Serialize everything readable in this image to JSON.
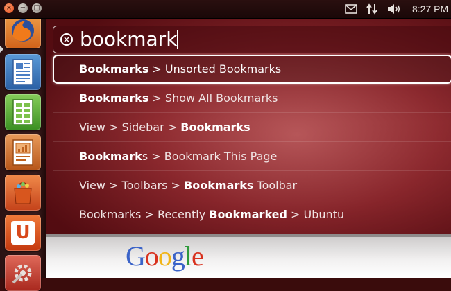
{
  "panel": {
    "close_glyph": "×",
    "minimize_glyph": "−",
    "maximize_glyph": "□",
    "clock": "8:27 PM"
  },
  "launcher": {
    "items": [
      {
        "icon": "firefox-icon",
        "color": "#e66a1d"
      },
      {
        "icon": "libreoffice-writer-icon",
        "color": "#2f6db4"
      },
      {
        "icon": "libreoffice-calc-icon",
        "color": "#3c9a2a"
      },
      {
        "icon": "libreoffice-impress-icon",
        "color": "#c45a1b"
      },
      {
        "icon": "software-center-icon",
        "color": "#d7541e"
      },
      {
        "icon": "ubuntu-one-icon",
        "color": "#dd4a14"
      },
      {
        "icon": "system-settings-icon",
        "color": "#b8342c"
      }
    ],
    "ubuntu_one_letter": "U"
  },
  "search": {
    "query": "bookmark",
    "clear_glyph": "×"
  },
  "results": [
    {
      "parts": [
        {
          "t": "Bookmarks",
          "b": true
        },
        {
          "t": " > Unsorted Bookmarks",
          "b": false
        }
      ],
      "selected": true
    },
    {
      "parts": [
        {
          "t": "Bookmarks",
          "b": true
        },
        {
          "t": " > Show All Bookmarks",
          "b": false
        }
      ],
      "selected": false
    },
    {
      "parts": [
        {
          "t": "View > Sidebar > ",
          "b": false
        },
        {
          "t": "Bookmarks",
          "b": true
        }
      ],
      "selected": false
    },
    {
      "parts": [
        {
          "t": "Bookmark",
          "b": true
        },
        {
          "t": "s > Bookmark This Page",
          "b": false
        }
      ],
      "selected": false
    },
    {
      "parts": [
        {
          "t": "View > Toolbars > ",
          "b": false
        },
        {
          "t": "Bookmarks",
          "b": true
        },
        {
          "t": " Toolbar",
          "b": false
        }
      ],
      "selected": false
    },
    {
      "parts": [
        {
          "t": "Bookmarks > Recently ",
          "b": false
        },
        {
          "t": "Bookmarked",
          "b": true
        },
        {
          "t": " > Ubuntu",
          "b": false
        }
      ],
      "selected": false
    }
  ],
  "browser": {
    "logo_letters": [
      "G",
      "o",
      "o",
      "g",
      "l",
      "e"
    ],
    "logo_colors": [
      "#3b63c8",
      "#d8321f",
      "#f1b417",
      "#3b63c8",
      "#2e9a3b",
      "#d8321f"
    ]
  }
}
